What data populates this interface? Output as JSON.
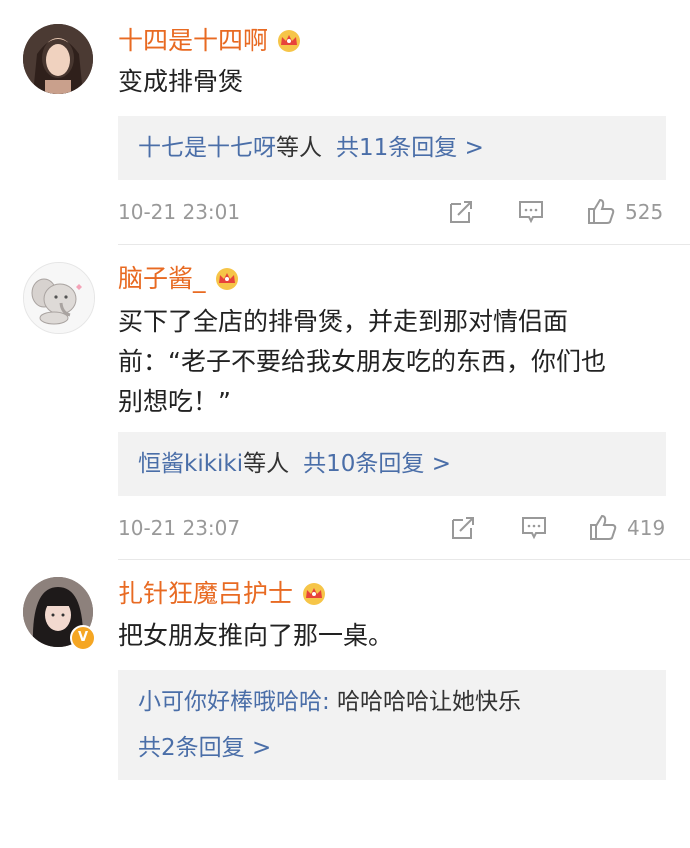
{
  "colors": {
    "username": "#e86a22",
    "reply_link": "#4a6ea8",
    "reply_bg": "#f2f2f2",
    "meta": "#999999",
    "badge": "#f5a623"
  },
  "comments": [
    {
      "username": "十四是十四啊",
      "avatar_icon": "avatar-photo-woman",
      "badge_icon": "crown-icon",
      "text": "变成排骨煲",
      "reply_summary": {
        "names": "十七是十七呀",
        "suffix": "等人",
        "count_label": "共11条回复 >"
      },
      "time": "10-21 23:01",
      "likes": "525"
    },
    {
      "username": "脑子酱_",
      "avatar_icon": "avatar-cartoon-elephant",
      "badge_icon": "crown-icon",
      "text": "买下了全店的排骨煲，并走到那对情侣面\n前：“老子不要给我女朋友吃的东西，你们也\n别想吃！”",
      "reply_summary": {
        "names": "恒酱kikiki",
        "suffix": "等人",
        "count_label": "共10条回复 >"
      },
      "time": "10-21 23:07",
      "likes": "419"
    },
    {
      "username": "扎针狂魔吕护士",
      "avatar_icon": "avatar-photo-girl",
      "badge_icon": "crown-icon",
      "verified": "V",
      "text": "把女朋友推向了那一桌。",
      "reply_preview": {
        "author": "小可你好棒哦哈哈:",
        "content": " 哈哈哈哈让她快乐",
        "count_label": "共2条回复 >"
      }
    }
  ]
}
